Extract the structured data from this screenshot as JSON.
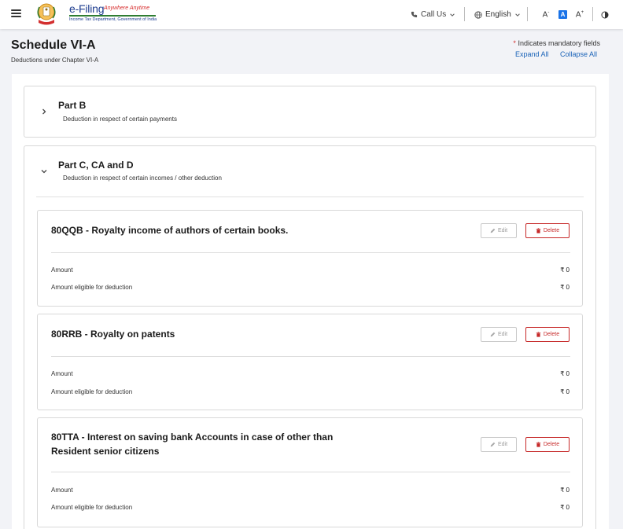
{
  "header": {
    "logo_title": "e-Filing",
    "logo_tagline": "Anywhere Anytime",
    "logo_subtitle": "Income Tax Department, Government of India",
    "call_us": "Call Us",
    "language": "English",
    "font_decrease": "A",
    "font_reset": "A",
    "font_increase": "A"
  },
  "page": {
    "title": "Schedule VI-A",
    "subtitle": "Deductions under Chapter VI-A",
    "mandatory_note": "Indicates mandatory fields",
    "mandatory_star": "*",
    "expand_all": "Expand All",
    "collapse_all": "Collapse All"
  },
  "sections": [
    {
      "title": "Part B",
      "subtitle": "Deduction in respect of certain payments",
      "expanded": false
    },
    {
      "title": "Part C, CA and D",
      "subtitle": "Deduction in respect of certain incomes / other deduction",
      "expanded": true
    }
  ],
  "cards": [
    {
      "title_line1": "80QQB - Royalty income of authors of certain books.",
      "title_line2": "",
      "edit_label": "Edit",
      "delete_label": "Delete",
      "rows": [
        {
          "label": "Amount",
          "value": "₹ 0"
        },
        {
          "label": "Amount eligible for deduction",
          "value": "₹ 0"
        }
      ]
    },
    {
      "title_line1": "80RRB - Royalty on patents",
      "title_line2": "",
      "edit_label": "Edit",
      "delete_label": "Delete",
      "rows": [
        {
          "label": "Amount",
          "value": "₹ 0"
        },
        {
          "label": "Amount eligible for deduction",
          "value": "₹ 0"
        }
      ]
    },
    {
      "title_line1": "80TTA - Interest on saving bank Accounts in case of other than",
      "title_line2": "Resident senior citizens",
      "edit_label": "Edit",
      "delete_label": "Delete",
      "rows": [
        {
          "label": "Amount",
          "value": "₹ 0"
        },
        {
          "label": "Amount eligible for deduction",
          "value": "₹ 0"
        }
      ]
    }
  ],
  "colors": {
    "link": "#1a63b8",
    "delete": "#c62828",
    "brand_blue": "#1d3c8f",
    "accent_blue": "#1a73e8"
  }
}
